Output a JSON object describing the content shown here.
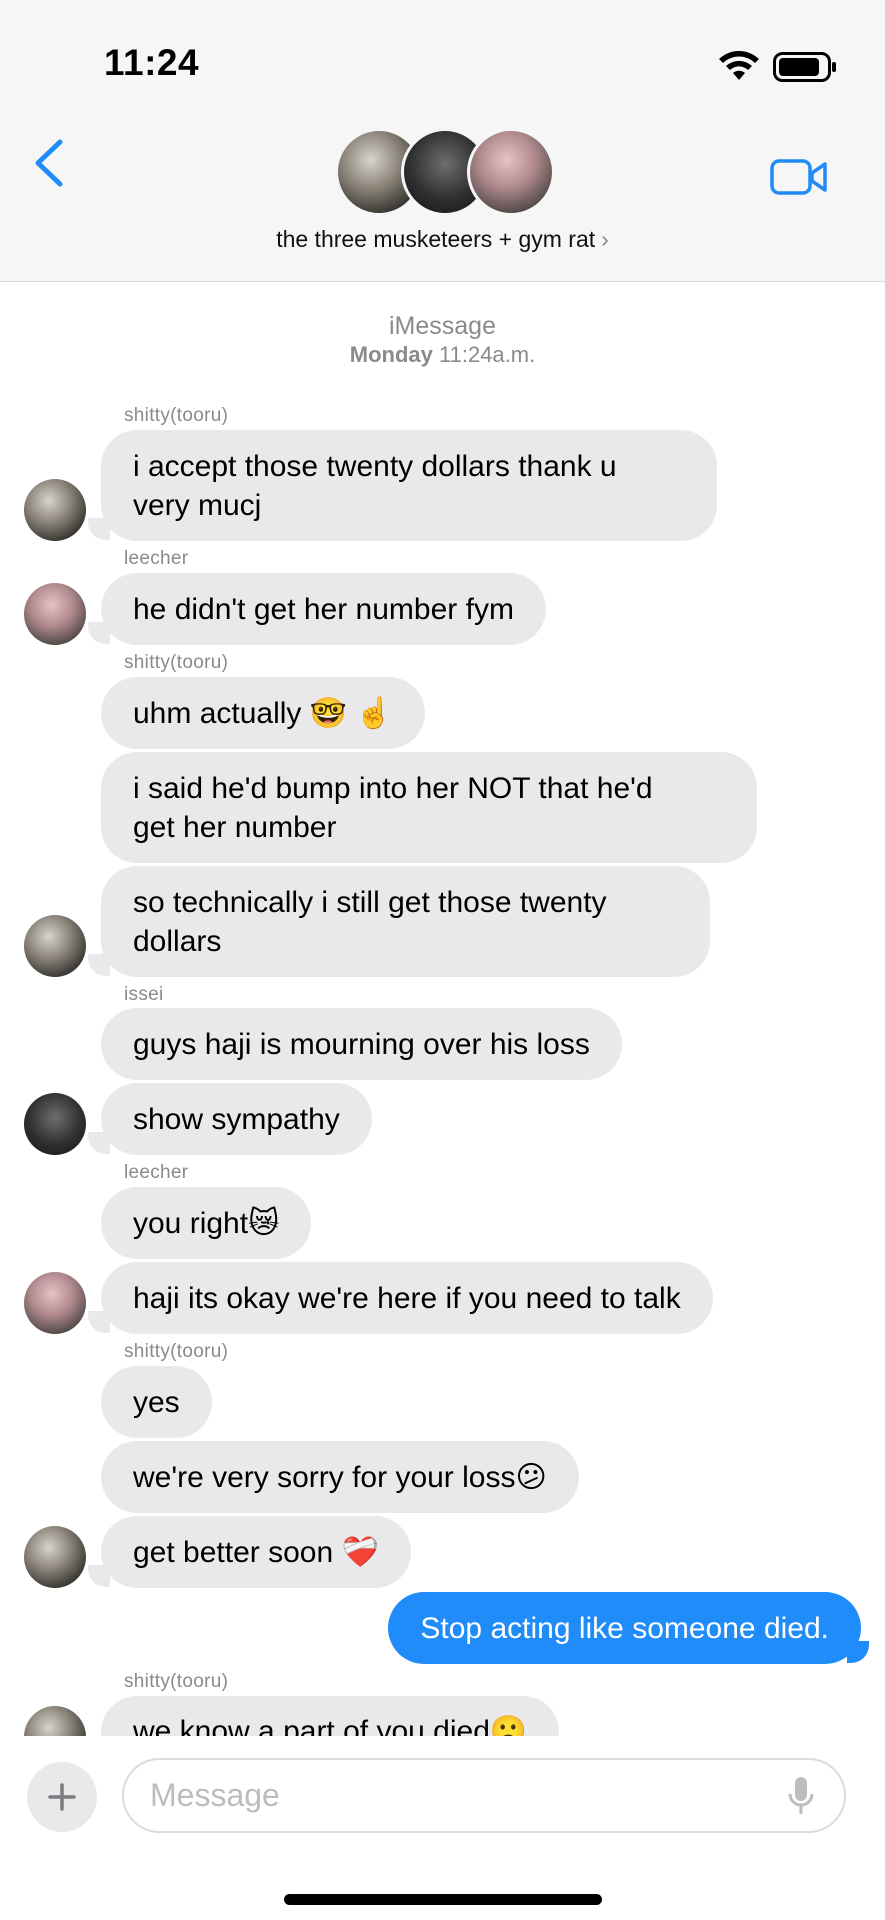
{
  "status_bar": {
    "time": "11:24"
  },
  "header": {
    "group_name": "the three musketeers + gym rat",
    "chevron": "›"
  },
  "thread": {
    "service": "iMessage",
    "day": "Monday",
    "time": "11:24a.m."
  },
  "messages": [
    {
      "sender": "shitty(tooru)",
      "lines": [
        "i accept those twenty dollars thank u",
        "very mucj"
      ]
    },
    {
      "sender": "leecher",
      "text": "he didn't get her number fym"
    },
    {
      "sender": "shitty(tooru)",
      "text": "uhm actually 🤓 ☝️"
    },
    {
      "text_lines": [
        "i said he'd bump into her NOT that he'd",
        "get her number"
      ]
    },
    {
      "text_lines": [
        "so technically i still get those twenty",
        "dollars"
      ]
    },
    {
      "sender": "issei",
      "text": "guys haji is mourning over his loss"
    },
    {
      "text": "show sympathy"
    },
    {
      "sender": "leecher",
      "text": "you right😿"
    },
    {
      "text": "haji its okay we're here if you need to talk"
    },
    {
      "sender": "shitty(tooru)",
      "text": "yes"
    },
    {
      "text": "we're very sorry for your loss😕"
    },
    {
      "text": "get better soon ❤️‍🩹"
    },
    {
      "mine": true,
      "text": "Stop acting like someone died."
    },
    {
      "sender": "shitty(tooru)",
      "text": "we know a part of you died🙁"
    }
  ],
  "composer": {
    "placeholder": "Message"
  },
  "icons": {
    "back": "chevron-left-icon",
    "video": "video-camera-icon",
    "plus": "plus-icon",
    "mic": "microphone-icon",
    "wifi": "wifi-icon",
    "battery": "battery-icon"
  },
  "colors": {
    "accent": "#1f8cf9",
    "incoming_bubble": "#e9e9eb",
    "meta_text": "#8a8a8e"
  }
}
